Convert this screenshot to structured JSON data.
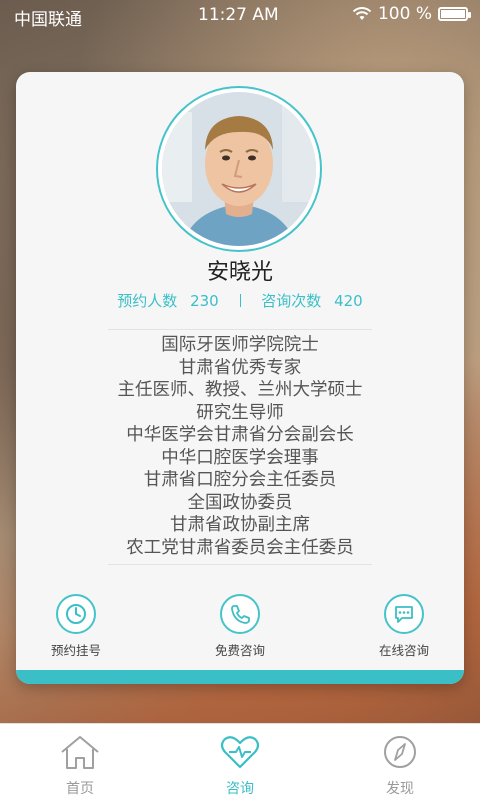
{
  "status_bar": {
    "carrier": "中国联通",
    "time": "11:27 AM",
    "battery": "100 %",
    "battery_level": 1.0
  },
  "doctor": {
    "name": "安晓光",
    "stats": [
      {
        "label": "预约人数",
        "value": "230"
      },
      {
        "label": "咨询次数",
        "value": "420"
      }
    ],
    "titles": [
      "国际牙医师学院院士",
      "甘肃省优秀专家",
      "主任医师、教授、兰州大学硕士",
      "研究生导师",
      "中华医学会甘肃省分会副会长",
      "中华口腔医学会理事",
      "甘肃省口腔分会主任委员",
      "全国政协委员",
      "甘肃省政协副主席",
      "农工党甘肃省委员会主任委员"
    ]
  },
  "actions": [
    {
      "label": "预约挂号",
      "icon": "clock-icon"
    },
    {
      "label": "免费咨询",
      "icon": "phone-icon"
    },
    {
      "label": "在线咨询",
      "icon": "chat-icon"
    }
  ],
  "tabs": [
    {
      "label": "首页",
      "icon": "home-icon",
      "active": false
    },
    {
      "label": "咨询",
      "icon": "heart-icon",
      "active": true
    },
    {
      "label": "发现",
      "icon": "compass-icon",
      "active": false
    }
  ],
  "colors": {
    "accent": "#3bbfc7",
    "tab_inactive": "#9a9a9a"
  }
}
